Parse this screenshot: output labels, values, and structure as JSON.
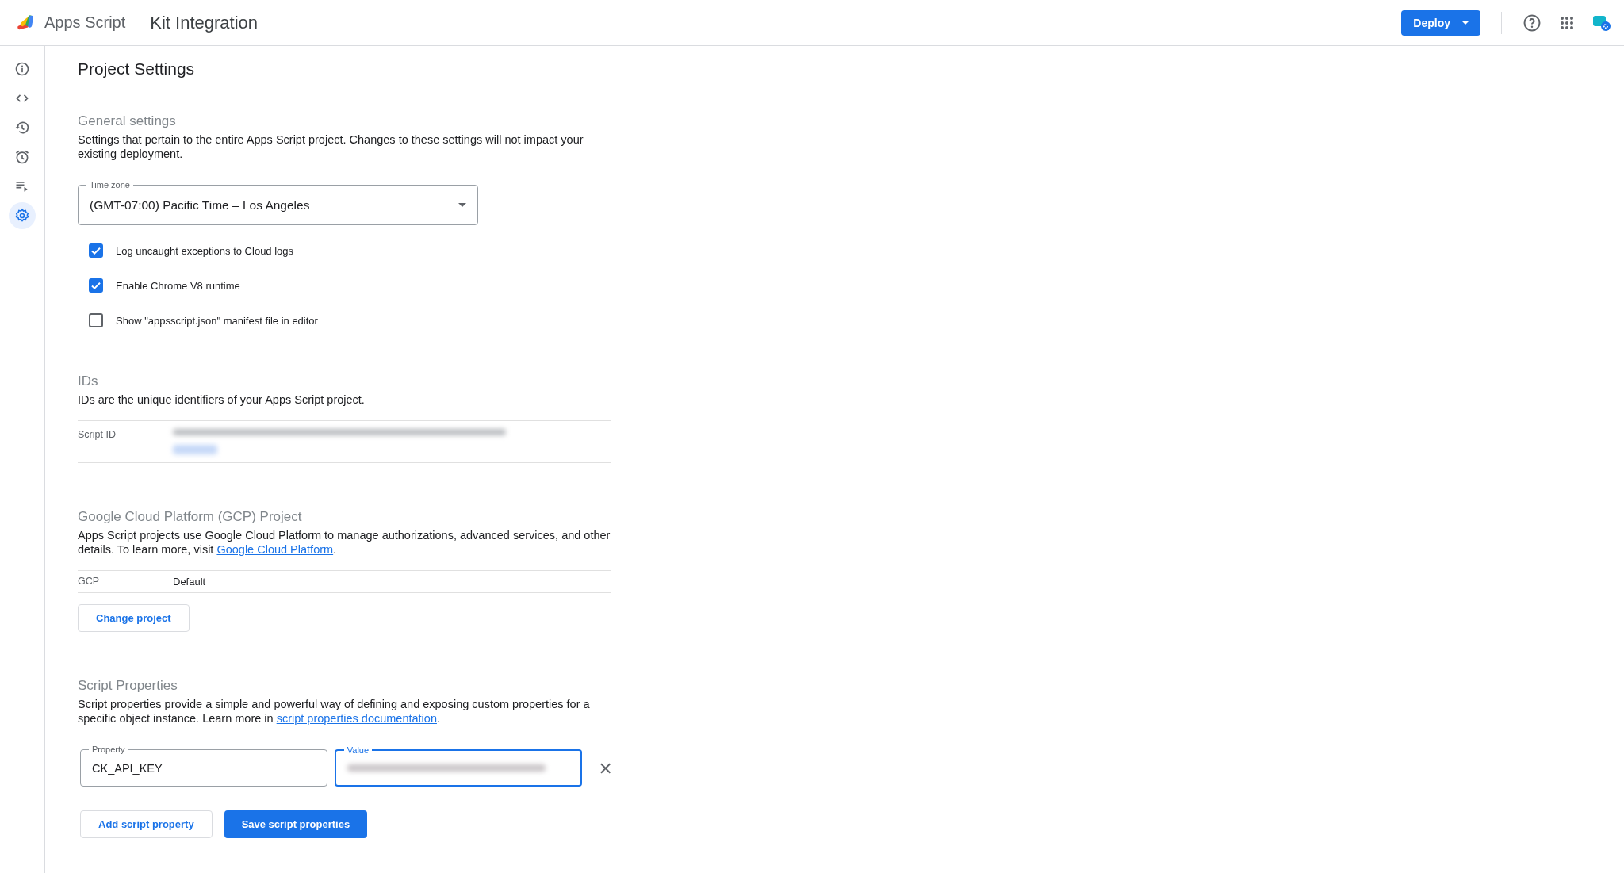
{
  "app": {
    "name": "Apps Script",
    "project_title": "Kit Integration"
  },
  "header": {
    "deploy_button": "Deploy"
  },
  "sidebar": {
    "items": [
      {
        "kind": "overview",
        "selected": false
      },
      {
        "kind": "editor",
        "selected": false
      },
      {
        "kind": "history",
        "selected": false
      },
      {
        "kind": "triggers",
        "selected": false
      },
      {
        "kind": "executions",
        "selected": false
      },
      {
        "kind": "settings",
        "selected": true
      }
    ]
  },
  "page_title": "Project Settings",
  "general": {
    "heading": "General settings",
    "description": "Settings that pertain to the entire Apps Script project. Changes to these settings will not impact your existing deployment.",
    "time_zone": {
      "label": "Time zone",
      "value": "(GMT-07:00) Pacific Time – Los Angeles"
    },
    "options": [
      {
        "label": "Log uncaught exceptions to Cloud logs",
        "checked": true
      },
      {
        "label": "Enable Chrome V8 runtime",
        "checked": true
      },
      {
        "label": "Show \"appsscript.json\" manifest file in editor",
        "checked": false
      }
    ]
  },
  "ids": {
    "heading": "IDs",
    "description": "IDs are the unique identifiers of your Apps Script project.",
    "rows": [
      {
        "label": "Script ID"
      }
    ]
  },
  "gcp": {
    "heading": "Google Cloud Platform (GCP) Project",
    "description": "Apps Script projects use Google Cloud Platform to manage authorizations, advanced services, and other details. To learn more, visit ",
    "link": "Google Cloud Platform",
    "tail": ".",
    "rows": [
      {
        "label": "GCP",
        "value": "Default"
      }
    ],
    "button": "Change project"
  },
  "script_properties": {
    "heading": "Script Properties",
    "description": "Script properties provide a simple and powerful way of defining and exposing custom properties for a specific object instance. Learn more in ",
    "link": "script properties documentation",
    "tail": ".",
    "properties": [
      {
        "property_label": "Property",
        "property": "CK_API_KEY",
        "value_label": "Value",
        "focused": true
      }
    ],
    "add_button": "Add script property",
    "save_button": "Save script properties"
  }
}
